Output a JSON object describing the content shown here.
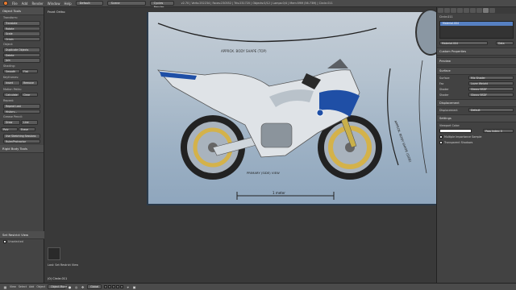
{
  "topbar": {
    "menus": [
      "File",
      "Add",
      "Render",
      "Window",
      "Help"
    ],
    "layout": "Default",
    "scene": "Scene",
    "engine": "Cycles Render",
    "stats": "v2.70 | Verts:252234 | Faces:230552 | Tris:231720 | Objects:0/12 | Lamps:0/4 | Mem:59M (56.73M) | Circle.011"
  },
  "toolshelf": {
    "header": "Object Tools",
    "groups": [
      {
        "title": "Transform:",
        "buttons": [
          "Translate",
          "Rotate",
          "Scale",
          "Origin"
        ]
      },
      {
        "title": "Object:",
        "buttons": [
          "Duplicate Objects",
          "Delete",
          "Join"
        ]
      },
      {
        "title": "Shading:",
        "pair": [
          "Smooth",
          "Flat"
        ]
      },
      {
        "title": "Keyframes:",
        "pair": [
          "Insert",
          "Remove"
        ]
      },
      {
        "title": "Motion Paths:",
        "pair": [
          "Calculate",
          "Clear"
        ]
      },
      {
        "title": "Repeat:",
        "buttons": [
          "Repeat Last",
          "History..."
        ]
      },
      {
        "title": "Grease Pencil:",
        "pair": [
          "Draw",
          "Line"
        ],
        "pair2": [
          "Poly",
          "Erase"
        ],
        "buttons": [
          "Use Sketching Sessions",
          "Ruler/Protractor"
        ]
      }
    ],
    "rigid_header": "Rigid Body Tools",
    "op_header": "Set Restrict View",
    "op_option": "Unselected",
    "last_op": "Last: Set Restrict View"
  },
  "viewport": {
    "label": "Front Ortho",
    "object_label": "(0) Circle.011",
    "blueprint_text": {
      "top": "APPROX. BODY SHAPE (TOP)",
      "side": "APPROX. BODY SHAPE (SIDE)",
      "primary": "PRIMARY (SIDE) VIEW",
      "meter": "1 meter"
    }
  },
  "bottombar": {
    "view": "View",
    "select": "Select",
    "add": "Add",
    "object": "Object",
    "mode": "Object Mode",
    "pivot": "Global"
  },
  "props": {
    "object": "Circle.011",
    "material_slot": "Material.004",
    "material_field": "Material.004",
    "data": "Data",
    "sections": {
      "custom": "Custom Properties",
      "preview": "Preview",
      "surface": "Surface",
      "displacement": "Displacement",
      "settings": "Settings"
    },
    "surface_label": "Surface",
    "surface_value": "Mix Shader",
    "fac_label": "Fac",
    "fac_value": "Layer Weight",
    "shader1_label": "Shader",
    "shader1_value": "Glossy BSDF",
    "shader2_label": "Shader",
    "shader2_value": "Glossy BSDF",
    "disp_label": "Displacement",
    "disp_value": "Default",
    "viewport_color": "Viewport Color:",
    "pass_index": "Pass Index: 0",
    "mis": "Multiple Importance Sample",
    "transparent_shadows": "Transparent Shadows"
  },
  "colors": {
    "accent": "#5680c2",
    "body_blue": "#1f4fa6",
    "disc_gold": "#d4b24a"
  }
}
